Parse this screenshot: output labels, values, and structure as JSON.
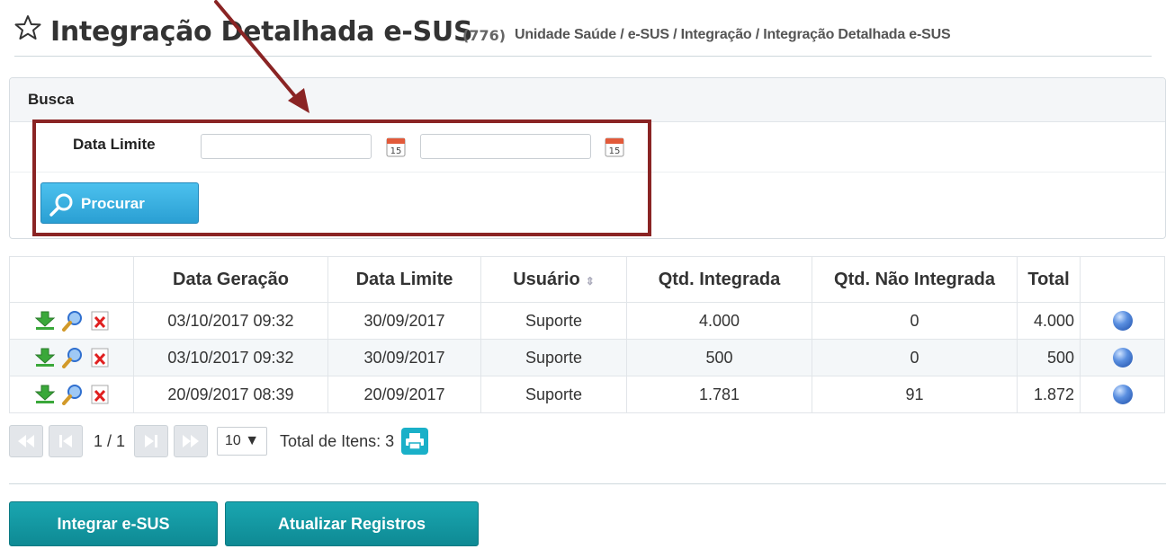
{
  "header": {
    "title": "Integração Detalhada e-SUS",
    "count": "(776)",
    "breadcrumb": "Unidade Saúde / e-SUS / Integração / Integração Detalhada e-SUS"
  },
  "busca": {
    "title": "Busca",
    "label_data_limite": "Data Limite",
    "date_from": "",
    "date_to": "",
    "calendar_day": "15",
    "procurar_label": "Procurar"
  },
  "table": {
    "columns": [
      "Data Geração",
      "Data Limite",
      "Usuário",
      "Qtd. Integrada",
      "Qtd. Não Integrada",
      "Total"
    ],
    "rows": [
      {
        "data_geracao": "03/10/2017 09:32",
        "data_limite": "30/09/2017",
        "usuario": "Suporte",
        "qtd_integrada": "4.000",
        "qtd_nao_integrada": "0",
        "total": "4.000"
      },
      {
        "data_geracao": "03/10/2017 09:32",
        "data_limite": "30/09/2017",
        "usuario": "Suporte",
        "qtd_integrada": "500",
        "qtd_nao_integrada": "0",
        "total": "500"
      },
      {
        "data_geracao": "20/09/2017 08:39",
        "data_limite": "20/09/2017",
        "usuario": "Suporte",
        "qtd_integrada": "1.781",
        "qtd_nao_integrada": "91",
        "total": "1.872"
      }
    ]
  },
  "pager": {
    "page_text": "1 / 1",
    "page_size": "10 ▼",
    "total_text": "Total de Itens: 3"
  },
  "actions": {
    "integrar_label": "Integrar e-SUS",
    "atualizar_label": "Atualizar Registros"
  },
  "colors": {
    "accent_blue": "#2a9fd3",
    "teal_button": "#0e8a94",
    "annotation": "#8a2424"
  }
}
